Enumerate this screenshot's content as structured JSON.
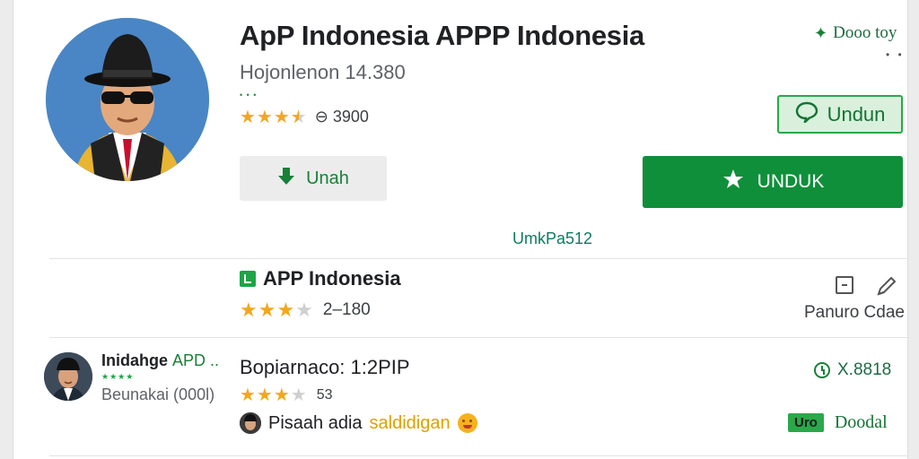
{
  "app": {
    "title": "ApP Indonesia APPP Indonesia",
    "subtitle": "Hojonlenon 14.380",
    "tiny_dots": "• • •",
    "rating_stars": 3.5,
    "rating_meta": "⊖ 3900"
  },
  "top_right": {
    "icon": "sparkle-plus-icon",
    "label": "Dooo toy",
    "dots": "• •"
  },
  "buttons": {
    "unduh_outline": "Undun",
    "unah": "Unah",
    "unduk": "UNDUK"
  },
  "link_mid": "UmkPa512",
  "section": {
    "title": "APP Indonesia",
    "rating_stars": 3,
    "rating_meta": "2–180",
    "review_label": "Panuro Cdae"
  },
  "developer": {
    "name": "Inidahge",
    "name_green": "APD ..",
    "stars": "★★★★",
    "count": "Beunakai (000l)"
  },
  "review": {
    "title": "Bopiarnaco: 1:2PIP",
    "rating_stars": 3,
    "rating_meta": "53",
    "comment_prefix": "Pisaah adia",
    "comment_highlight": "saldidigan",
    "right_value": "X.8818",
    "badge": "Uro",
    "badge_label": "Doodal"
  },
  "colors": {
    "primary_green": "#0f8f3a",
    "star": "#f2a81d",
    "link_teal": "#0f7a63",
    "avatar_bg": "#4a86c5"
  }
}
